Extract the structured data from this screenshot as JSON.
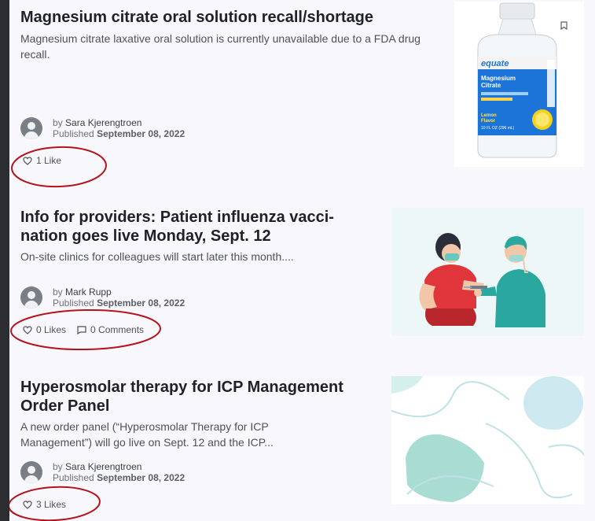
{
  "articles": [
    {
      "title": "Magnesium citrate oral solution recall/shortage",
      "summary": "Magnesium citrate laxative oral solution is currently unavailable due to a FDA drug recall.",
      "by_prefix": "by",
      "author": "Sara Kjerengtroen",
      "published_prefix": "Published",
      "date": "September 08, 2022",
      "likes": "1 Like",
      "image_icon": "magnesium-citrate-bottle-image",
      "bottle_text": {
        "brand": "equate",
        "line1": "Magnesium",
        "line2": "Citrate",
        "flavor1": "Lemon",
        "flavor2": "Flavor",
        "volume": "10 FL OZ (296 mL)"
      }
    },
    {
      "title_line1": "Info for providers: Patient influenza vacci-",
      "title_line2": "nation goes live Monday, Sept. 12",
      "summary": "On-site clinics for colleagues will start later this month....",
      "by_prefix": "by",
      "author": "Mark Rupp",
      "published_prefix": "Published",
      "date": "September 08, 2022",
      "likes": "0 Likes",
      "comments": "0 Comments",
      "image_icon": "vaccination-illustration-image"
    },
    {
      "title_line1": "Hyperosmolar therapy for ICP Management",
      "title_line2": "Order Panel",
      "summary_line1": "A new order panel (“Hyperosmolar Therapy for ICP",
      "summary_line2": "Management”) will go live on Sept. 12 and the ICP...",
      "by_prefix": "by",
      "author": "Sara Kjerengtroen",
      "published_prefix": "Published",
      "date": "September 08, 2022",
      "likes": "3 Likes",
      "image_icon": "abstract-teal-shapes-image"
    }
  ],
  "colors": {
    "page_bg": "#f8f8fc",
    "outer_bg": "#2b2d31",
    "annotation_red": "#b5121b",
    "teal": "#b7e2dc"
  }
}
